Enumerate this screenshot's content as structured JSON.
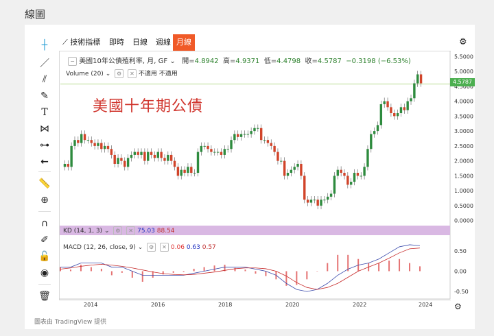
{
  "page": {
    "title": "線圖"
  },
  "toolbar": {
    "indicators_label": "技術指標",
    "tabs": [
      {
        "label": "即時",
        "active": false
      },
      {
        "label": "日線",
        "active": false
      },
      {
        "label": "週線",
        "active": false
      },
      {
        "label": "月線",
        "active": true
      }
    ]
  },
  "legend": {
    "symbol": "美國10年公債殖利率, 月, GF",
    "open_label": "開",
    "open": "4.8942",
    "high_label": "高",
    "high": "4.9371",
    "low_label": "低",
    "low": "4.4798",
    "close_label": "收",
    "close": "4.5787",
    "change": "−0.3198 (−6.53%)"
  },
  "volume_legend": {
    "label": "Volume (20)",
    "value1": "不適用",
    "value2": "不適用"
  },
  "overlay_title": "美國十年期公債",
  "price_tag": "4.5787",
  "kd": {
    "label": "KD (14, 1, 3)",
    "k": "75.03",
    "d": "88.54"
  },
  "macd": {
    "label": "MACD (12, 26, close, 9)",
    "hist": "0.06",
    "macd": "0.63",
    "signal": "0.57"
  },
  "footer": "圖表由 TradingView 提供",
  "colors": {
    "up": "#2e8b3e",
    "down": "#d1442a",
    "accent": "#f05a28",
    "kd_band": "#d9b8e3"
  },
  "chart_data": {
    "type": "candlestick",
    "price_axis_ticks": [
      "5.5000",
      "5.0000",
      "4.5000",
      "4.0000",
      "3.5000",
      "3.0000",
      "2.5000",
      "2.0000",
      "1.5000",
      "1.0000",
      "0.5000",
      "0.0000"
    ],
    "macd_axis_ticks": [
      "0.50",
      "0.00",
      "-0.50"
    ],
    "x_ticks": [
      "2014",
      "2016",
      "2018",
      "2020",
      "2022",
      "2024"
    ],
    "ylim": [
      -0.1,
      5.6
    ],
    "closes": [
      1.9,
      1.8,
      2.5,
      2.7,
      2.6,
      2.9,
      2.7,
      2.7,
      2.6,
      2.5,
      2.6,
      2.4,
      2.5,
      2.4,
      2.2,
      1.9,
      2.1,
      2.0,
      1.8,
      2.1,
      2.2,
      2.3,
      2.2,
      2.3,
      2.0,
      2.3,
      2.2,
      2.1,
      2.3,
      2.1,
      2.0,
      2.2,
      2.0,
      1.8,
      1.5,
      1.7,
      1.6,
      1.8,
      1.6,
      1.6,
      2.3,
      2.5,
      2.5,
      2.4,
      2.3,
      2.3,
      2.3,
      2.2,
      2.4,
      2.4,
      2.7,
      2.9,
      2.8,
      2.9,
      2.9,
      2.9,
      3.0,
      3.1,
      3.1,
      2.7,
      2.7,
      2.6,
      2.5,
      2.3,
      2.0,
      2.0,
      1.5,
      1.6,
      1.7,
      1.8,
      1.9,
      1.5,
      0.7,
      0.6,
      0.7,
      0.7,
      0.5,
      0.7,
      0.7,
      0.8,
      0.9,
      1.5,
      1.7,
      1.6,
      1.5,
      1.2,
      1.3,
      1.6,
      1.5,
      1.5,
      1.8,
      2.4,
      2.9,
      3.0,
      3.2,
      3.9,
      4.0,
      3.8,
      3.6,
      3.5,
      3.6,
      3.8,
      3.7,
      4.0,
      4.1,
      4.6,
      4.9,
      4.6
    ],
    "macd_line": [
      0.1,
      0.1,
      0.2,
      0.2,
      0.2,
      0.1,
      0.1,
      0.0,
      -0.1,
      -0.1,
      -0.1,
      -0.1,
      -0.1,
      -0.05,
      0.0,
      0.05,
      0.1,
      0.1,
      0.1,
      0.05,
      0.0,
      -0.1,
      -0.3,
      -0.45,
      -0.5,
      -0.45,
      -0.3,
      -0.1,
      0.05,
      0.15,
      0.2,
      0.3,
      0.45,
      0.6,
      0.65,
      0.63
    ],
    "signal_line": [
      0.05,
      0.08,
      0.12,
      0.15,
      0.17,
      0.15,
      0.12,
      0.08,
      0.03,
      -0.02,
      -0.06,
      -0.08,
      -0.09,
      -0.08,
      -0.05,
      -0.02,
      0.02,
      0.06,
      0.08,
      0.08,
      0.06,
      0.0,
      -0.12,
      -0.28,
      -0.4,
      -0.45,
      -0.4,
      -0.3,
      -0.15,
      0.0,
      0.1,
      0.2,
      0.32,
      0.45,
      0.55,
      0.57
    ]
  }
}
